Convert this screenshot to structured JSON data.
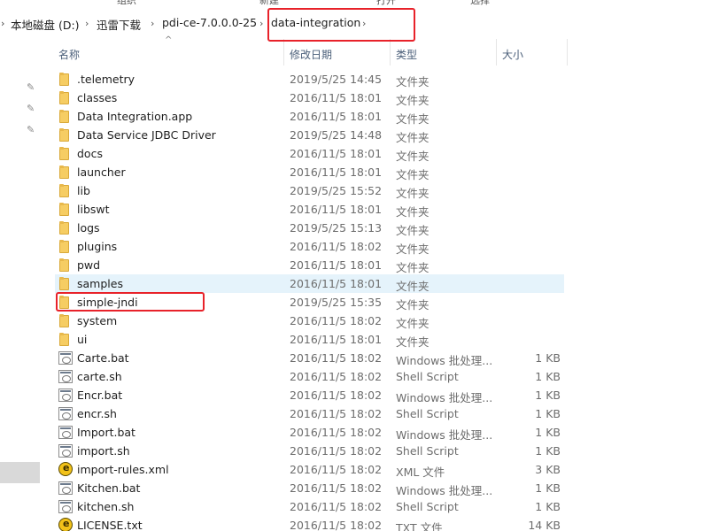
{
  "breadcrumb": {
    "items": [
      "本地磁盘 (D:)",
      "迅雷下载",
      "pdi-ce-7.0.0.0-25",
      "data-integration"
    ]
  },
  "ribbon": {
    "labels": [
      "组织",
      "新建",
      "打开",
      "选择"
    ]
  },
  "columns": {
    "name": "名称",
    "modified": "修改日期",
    "type": "类型",
    "size": "大小"
  },
  "files": [
    {
      "name": ".telemetry",
      "date": "2019/5/25 14:45",
      "type": "文件夹",
      "size": "",
      "icon": "folder-icon"
    },
    {
      "name": "classes",
      "date": "2016/11/5 18:01",
      "type": "文件夹",
      "size": "",
      "icon": "folder-icon"
    },
    {
      "name": "Data Integration.app",
      "date": "2016/11/5 18:01",
      "type": "文件夹",
      "size": "",
      "icon": "folder-icon"
    },
    {
      "name": "Data Service JDBC Driver",
      "date": "2019/5/25 14:48",
      "type": "文件夹",
      "size": "",
      "icon": "folder-icon"
    },
    {
      "name": "docs",
      "date": "2016/11/5 18:01",
      "type": "文件夹",
      "size": "",
      "icon": "folder-icon"
    },
    {
      "name": "launcher",
      "date": "2016/11/5 18:01",
      "type": "文件夹",
      "size": "",
      "icon": "folder-icon"
    },
    {
      "name": "lib",
      "date": "2019/5/25 15:52",
      "type": "文件夹",
      "size": "",
      "icon": "folder-icon"
    },
    {
      "name": "libswt",
      "date": "2016/11/5 18:01",
      "type": "文件夹",
      "size": "",
      "icon": "folder-icon"
    },
    {
      "name": "logs",
      "date": "2019/5/25 15:13",
      "type": "文件夹",
      "size": "",
      "icon": "folder-icon"
    },
    {
      "name": "plugins",
      "date": "2016/11/5 18:02",
      "type": "文件夹",
      "size": "",
      "icon": "folder-icon"
    },
    {
      "name": "pwd",
      "date": "2016/11/5 18:01",
      "type": "文件夹",
      "size": "",
      "icon": "folder-icon"
    },
    {
      "name": "samples",
      "date": "2016/11/5 18:01",
      "type": "文件夹",
      "size": "",
      "icon": "folder-icon"
    },
    {
      "name": "simple-jndi",
      "date": "2019/5/25 15:35",
      "type": "文件夹",
      "size": "",
      "icon": "folder-icon"
    },
    {
      "name": "system",
      "date": "2016/11/5 18:02",
      "type": "文件夹",
      "size": "",
      "icon": "folder-icon"
    },
    {
      "name": "ui",
      "date": "2016/11/5 18:01",
      "type": "文件夹",
      "size": "",
      "icon": "folder-icon"
    },
    {
      "name": "Carte.bat",
      "date": "2016/11/5 18:02",
      "type": "Windows 批处理...",
      "size": "1 KB",
      "icon": "batch-file-icon"
    },
    {
      "name": "carte.sh",
      "date": "2016/11/5 18:02",
      "type": "Shell Script",
      "size": "1 KB",
      "icon": "script-file-icon"
    },
    {
      "name": "Encr.bat",
      "date": "2016/11/5 18:02",
      "type": "Windows 批处理...",
      "size": "1 KB",
      "icon": "batch-file-icon"
    },
    {
      "name": "encr.sh",
      "date": "2016/11/5 18:02",
      "type": "Shell Script",
      "size": "1 KB",
      "icon": "script-file-icon"
    },
    {
      "name": "Import.bat",
      "date": "2016/11/5 18:02",
      "type": "Windows 批处理...",
      "size": "1 KB",
      "icon": "batch-file-icon"
    },
    {
      "name": "import.sh",
      "date": "2016/11/5 18:02",
      "type": "Shell Script",
      "size": "1 KB",
      "icon": "script-file-icon"
    },
    {
      "name": "import-rules.xml",
      "date": "2016/11/5 18:02",
      "type": "XML 文件",
      "size": "3 KB",
      "icon": "xml-file-icon"
    },
    {
      "name": "Kitchen.bat",
      "date": "2016/11/5 18:02",
      "type": "Windows 批处理...",
      "size": "1 KB",
      "icon": "batch-file-icon"
    },
    {
      "name": "kitchen.sh",
      "date": "2016/11/5 18:02",
      "type": "Shell Script",
      "size": "1 KB",
      "icon": "script-file-icon"
    },
    {
      "name": "LICENSE.txt",
      "date": "2016/11/5 18:02",
      "type": "TXT 文件",
      "size": "14 KB",
      "icon": "xml-file-icon"
    }
  ],
  "highlighted_row": "samples",
  "annotations": {
    "color": "#e8222a",
    "boxed": [
      "data-integration",
      "simple-jndi"
    ]
  }
}
